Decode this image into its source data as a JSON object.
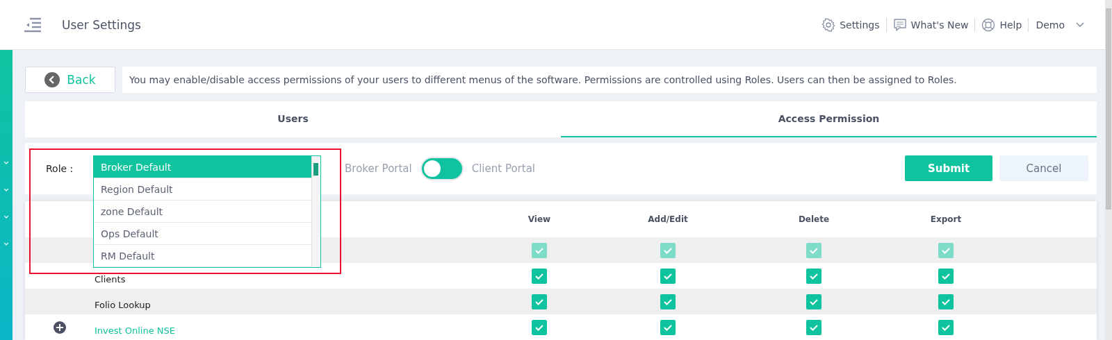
{
  "header": {
    "title": "User Settings",
    "links": [
      {
        "kind": "gear",
        "label": "Settings"
      },
      {
        "kind": "chat",
        "label": "What's New"
      },
      {
        "kind": "lifebuoy",
        "label": "Help"
      }
    ],
    "user": "Demo"
  },
  "back": "Back",
  "info": "You may enable/disable access permissions of your users to different menus of the software. Permissions are controlled using Roles. Users can then be assigned to Roles.",
  "tabs": [
    {
      "label": "Users",
      "selected": false
    },
    {
      "label": "Access Permission",
      "selected": true
    }
  ],
  "role": {
    "label": "Role :",
    "options": [
      {
        "label": "Broker Default",
        "selected": true
      },
      {
        "label": "Region Default",
        "selected": false
      },
      {
        "label": "zone Default",
        "selected": false
      },
      {
        "label": "Ops Default",
        "selected": false
      },
      {
        "label": "RM Default",
        "selected": false
      }
    ]
  },
  "portal": {
    "left": "Broker Portal",
    "right": "Client Portal",
    "client_selected": false
  },
  "buttons": {
    "submit": "Submit",
    "cancel": "Cancel"
  },
  "table": {
    "columns": [
      "View",
      "Add/Edit",
      "Delete",
      "Export"
    ],
    "rows": [
      {
        "kind": "item",
        "disabled": true,
        "checks": [
          true,
          true,
          true,
          true
        ]
      },
      {
        "kind": "item",
        "label": "Clients",
        "disabled": false,
        "checks": [
          true,
          true,
          true,
          true
        ]
      },
      {
        "kind": "item",
        "label": "Folio Lookup",
        "disabled": false,
        "checks": [
          true,
          true,
          true,
          true
        ]
      },
      {
        "kind": "group",
        "label": "Invest Online NSE",
        "disabled": false,
        "checks": [
          true,
          true,
          true,
          true
        ]
      }
    ]
  }
}
